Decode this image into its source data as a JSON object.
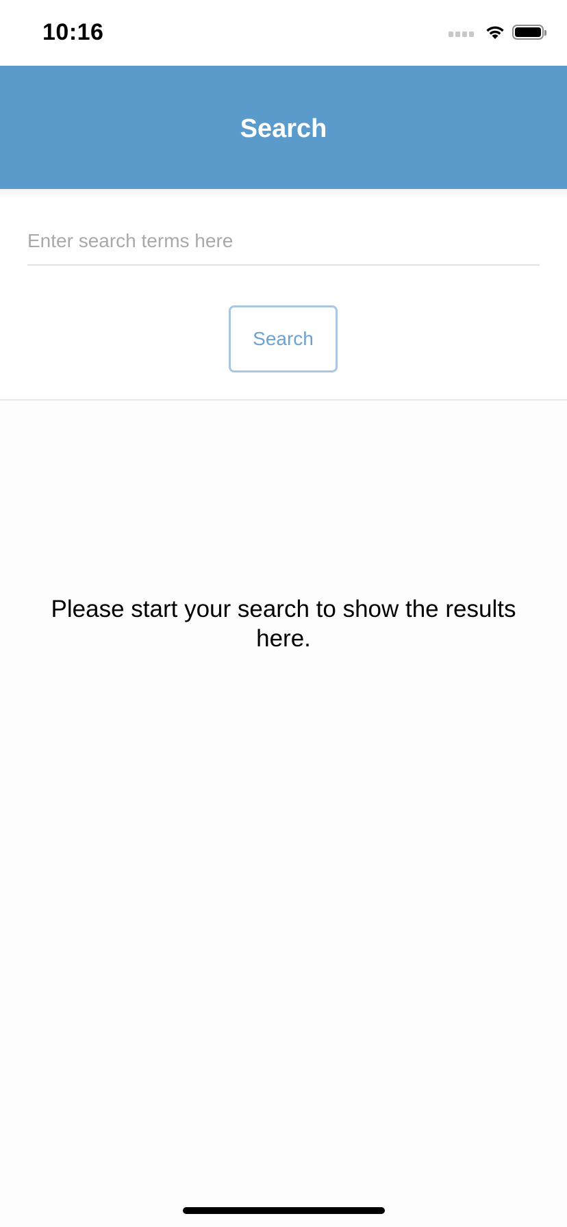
{
  "status_bar": {
    "time": "10:16",
    "icons": [
      "cellular-signal-icon",
      "wifi-icon",
      "battery-icon"
    ]
  },
  "header": {
    "title": "Search",
    "background_color": "#5a9bcc"
  },
  "search": {
    "input_value": "",
    "placeholder": "Enter search terms here",
    "button_label": "Search",
    "button_color": "#6ea2cf"
  },
  "results": {
    "empty_message": "Please start your search to show the results here."
  }
}
